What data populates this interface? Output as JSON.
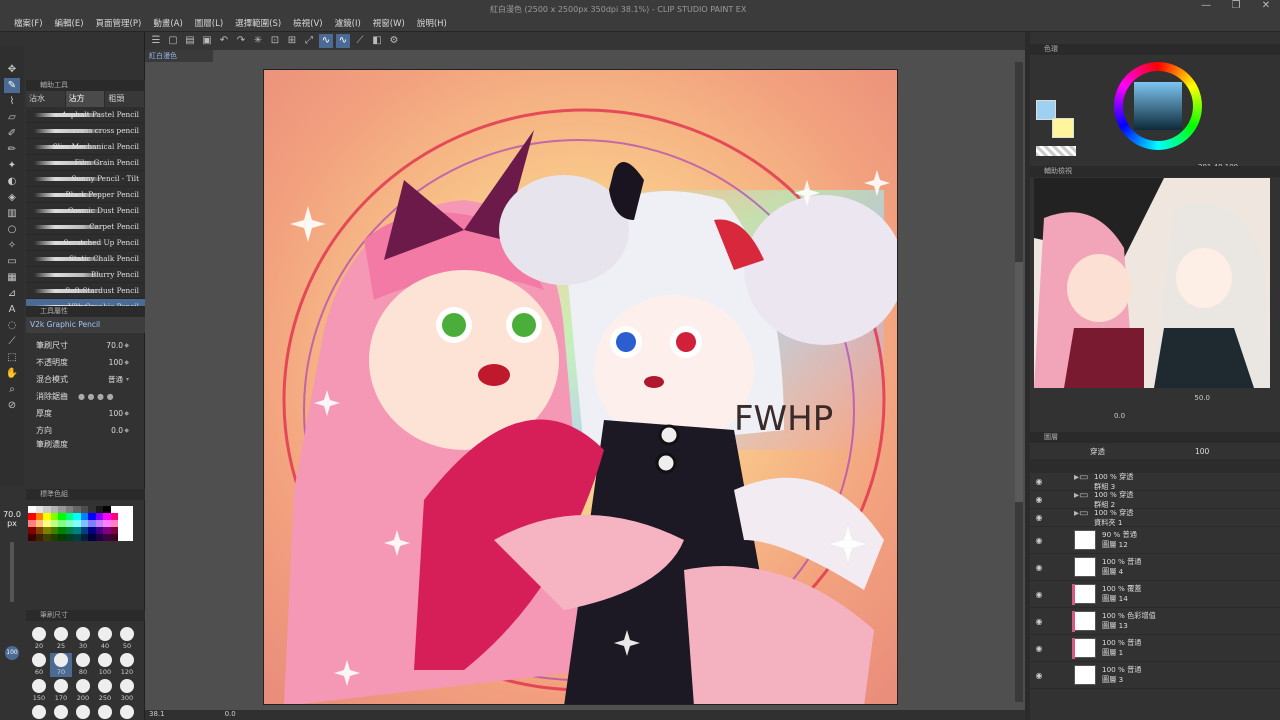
{
  "window": {
    "title": "紅白漫色 (2500 x 2500px 350dpi 38.1%) - CLIP STUDIO PAINT EX",
    "controls": [
      "—",
      "❐",
      "✕"
    ]
  },
  "menu": [
    "檔案(F)",
    "編輯(E)",
    "頁面管理(P)",
    "動畫(A)",
    "圖層(L)",
    "選擇範圍(S)",
    "檢視(V)",
    "濾鏡(I)",
    "視窗(W)",
    "說明(H)"
  ],
  "document_tab": "紅白漫色",
  "tool_panel": {
    "header": "輔助工具",
    "tabs": [
      "沾水",
      "沾方",
      "粗頭"
    ],
    "active_tab": 1,
    "brushes": [
      "Asphalt Pastel Pencil",
      "cross cross pencil",
      "Slim Mechanical Pencil",
      "Film Grain Pencil",
      "Sunny Pencil - Tilt",
      "Black Pepper Pencil",
      "Cosmic Dust Pencil",
      "Carpet Pencil",
      "Scratched Up Pencil",
      "Static Chalk Pencil",
      "Blurry Pencil",
      "Soft Stardust Pencil",
      "V2k Graphic Pencil"
    ],
    "active_brush": 12
  },
  "tool_property": {
    "header": "工具屬性",
    "selected_brush": "V2k Graphic Pencil",
    "brush_size_label": "筆刷尺寸",
    "brush_size": "70.0",
    "opacity_label": "不透明度",
    "opacity": "100",
    "blend_label": "混合模式",
    "blend": "普通",
    "aa_label": "消除鋸齒",
    "thickness_label": "厚度",
    "thickness": "100",
    "direction_label": "方向",
    "direction": "0.0",
    "more_label": "筆刷濃度"
  },
  "color_set": {
    "header": "標準色組",
    "swatches": [
      "#ffffff",
      "#e6e6e6",
      "#cccccc",
      "#b3b3b3",
      "#999999",
      "#808080",
      "#666666",
      "#4d4d4d",
      "#333333",
      "#1a1a1a",
      "#000000",
      "#ffffff",
      "#ffffff",
      "#ffffff",
      "#ff0000",
      "#ff8000",
      "#ffff00",
      "#80ff00",
      "#00ff00",
      "#00ff80",
      "#00ffff",
      "#0080ff",
      "#0000ff",
      "#8000ff",
      "#ff00ff",
      "#ff0080",
      "#ffffff",
      "#ffffff",
      "#ff8080",
      "#ffc080",
      "#ffff80",
      "#c0ff80",
      "#80ff80",
      "#80ffc0",
      "#80ffff",
      "#80c0ff",
      "#8080ff",
      "#c080ff",
      "#ff80ff",
      "#ff80c0",
      "#ffffff",
      "#ffffff",
      "#800000",
      "#804000",
      "#808000",
      "#408000",
      "#008000",
      "#008040",
      "#008080",
      "#004080",
      "#000080",
      "#400080",
      "#800080",
      "#800040",
      "#ffffff",
      "#ffffff",
      "#400000",
      "#402000",
      "#404000",
      "#204000",
      "#004000",
      "#004020",
      "#004040",
      "#002040",
      "#000040",
      "#200040",
      "#400040",
      "#400020",
      "#ffffff",
      "#ffffff"
    ]
  },
  "brush_size_panel": {
    "header": "筆刷尺寸",
    "sizes": [
      "20",
      "25",
      "30",
      "40",
      "50",
      "60",
      "70",
      "80",
      "100",
      "120",
      "150",
      "170",
      "200",
      "250",
      "300",
      "400",
      "500",
      "600",
      "700",
      "800",
      "1000",
      "1200",
      "1500",
      "1700",
      "2000"
    ],
    "active": "70"
  },
  "left_strip": {
    "size": "70.0",
    "unit": "px",
    "preset": "100"
  },
  "artwork": {
    "text": "FWHP"
  },
  "status": {
    "zoom": "38.1",
    "angle": "0.0"
  },
  "color_panel": {
    "header": "色環",
    "values": [
      "201",
      "40",
      "100"
    ],
    "primary": "#9ed0f2",
    "secondary": "#fff59a"
  },
  "navigator": {
    "header": "輔助檢視",
    "zoom": "50.0",
    "rotate": "0.0"
  },
  "layer_panel": {
    "header": "圖層",
    "blend": "穿透",
    "opacity": "100",
    "layers": [
      {
        "name": "群組 3",
        "mode": "100 % 穿透",
        "type": "folder"
      },
      {
        "name": "群組 2",
        "mode": "100 % 穿透",
        "type": "folder"
      },
      {
        "name": "資料夾 1",
        "mode": "100 % 穿透",
        "type": "folder"
      },
      {
        "name": "圖層 12",
        "mode": "90 % 普通",
        "type": "layer"
      },
      {
        "name": "圖層 4",
        "mode": "100 % 普通",
        "type": "layer"
      },
      {
        "name": "圖層 14",
        "mode": "100 % 覆蓋",
        "type": "layer"
      },
      {
        "name": "圖層 13",
        "mode": "100 % 色彩增值",
        "type": "layer"
      },
      {
        "name": "圖層 1",
        "mode": "100 % 普通",
        "type": "layer"
      },
      {
        "name": "圖層 3",
        "mode": "100 % 普通",
        "type": "layer"
      },
      {
        "name": "群組 1",
        "mode": "100 % 穿透",
        "type": "folder"
      }
    ]
  },
  "icons": {
    "move": "move-icon",
    "eyedropper": "eyedropper-icon",
    "pen": "pen-icon",
    "eraser": "eraser-icon",
    "fill": "fill-icon",
    "text": "text-icon",
    "hand": "hand-icon",
    "eye": "eye-icon"
  }
}
